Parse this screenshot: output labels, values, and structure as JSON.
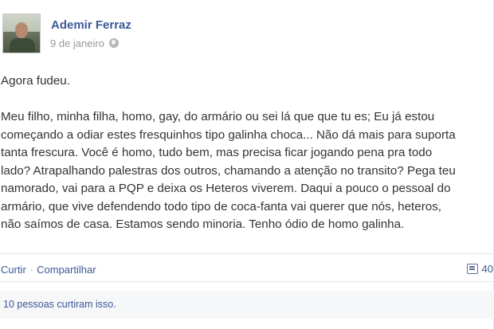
{
  "post": {
    "author": "Ademir Ferraz",
    "date": "9 de janeiro",
    "privacy_icon": "globe-icon",
    "lines": [
      "Agora fudeu.",
      "",
      "Meu filho, minha filha, homo, gay, do armário ou sei lá que que tu es; Eu já estou",
      "começando a odiar estes fresquinhos tipo galinha choca... Não dá mais para suporta",
      "tanta frescura. Você é homo, tudo bem, mas precisa ficar jogando pena pra todo",
      "lado? Atrapalhando palestras dos outros, chamando a atenção no transito? Pega teu",
      "namorado, vai para a PQP e deixa os Heteros viverem. Daqui a pouco o pessoal do",
      "armário, que vive defendendo todo tipo de coca-fanta vai querer que nós, heteros,",
      "não saímos de casa. Estamos sendo minoria. Tenho ódio de homo galinha."
    ]
  },
  "actions": {
    "like_label": "Curtir",
    "separator": "·",
    "share_label": "Compartilhar",
    "comment_icon": "comment-icon",
    "comment_count": "40"
  },
  "likes": {
    "text": "10 pessoas curtiram isso."
  },
  "colors": {
    "link": "#3b5998",
    "text": "#333333",
    "muted": "#999999"
  }
}
